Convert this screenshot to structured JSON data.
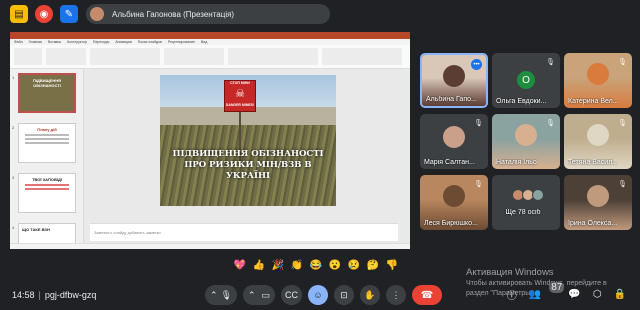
{
  "top_icons": [
    "sticky-note-icon",
    "record-icon",
    "whiteboard-icon"
  ],
  "presenter": {
    "label": "Альбина Гапонова (Презентація)"
  },
  "ppt": {
    "menu": [
      "Файл",
      "Главная",
      "Вставка",
      "Конструктор",
      "Переходы",
      "Анимация",
      "Показ слайдов",
      "Рецензирование",
      "Вид"
    ],
    "thumbnails": [
      {
        "num": "1",
        "title": "ПІДВИЩЕННЯ ОБІЗНАНОСТІ"
      },
      {
        "num": "2",
        "title": "Плану дій"
      },
      {
        "num": "3",
        "title": "ТВОЇ ЗАПОВІДІ"
      },
      {
        "num": "4",
        "title": "ЩО ТАКЕ ВЗН"
      }
    ],
    "slide": {
      "sign_skull": "☠",
      "sign_text": "DANGER MINES!",
      "sign_top": "СТОП МІНИ",
      "headline_1": "ПІДВИЩЕННЯ ОБІЗНАНОСТІ",
      "headline_2": "ПРО РИЗИКИ МІН/ВЗВ В УКРАЇНІ"
    },
    "notes_placeholder": "Заметки к слайду добавить заметки"
  },
  "participants": [
    {
      "name": "Альбина Гапо...",
      "kind": "video",
      "speaking": true,
      "colors": [
        "#d9c7b8",
        "#5b3d33"
      ]
    },
    {
      "name": "Ольга Евдоки...",
      "kind": "letter",
      "letter": "О",
      "colors": [
        "#3c4043",
        "#1e8e3e"
      ]
    },
    {
      "name": "Катерина Вел...",
      "kind": "video",
      "colors": [
        "#c9a37a",
        "#d97b3d"
      ]
    },
    {
      "name": "Марія Салтан...",
      "kind": "avatar",
      "colors": [
        "#3c4043",
        "#caa08a"
      ]
    },
    {
      "name": "Наталія Ільо",
      "kind": "video",
      "colors": [
        "#8aa2a0",
        "#d7b08f"
      ]
    },
    {
      "name": "Тетяна Васил...",
      "kind": "video",
      "colors": [
        "#bfae8e",
        "#e0d6c4"
      ]
    },
    {
      "name": "Леся Бирюшко...",
      "kind": "video",
      "colors": [
        "#b8865f",
        "#6d4b33"
      ]
    },
    {
      "name": "Ще 78 осіб",
      "kind": "more",
      "colors": [
        "#3c4043",
        "#c58b6b"
      ]
    },
    {
      "name": "Ірина Олекса...",
      "kind": "video",
      "colors": [
        "#4d4036",
        "#c09a7d"
      ]
    }
  ],
  "reactions": [
    "💖",
    "👍",
    "🎉",
    "👏",
    "😂",
    "😮",
    "😢",
    "🤔",
    "👎"
  ],
  "activation": {
    "title": "Активация Windows",
    "line1": "Чтобы активировать Windows, перейдите в",
    "line2": "раздел \"Параметры\"."
  },
  "meeting": {
    "time": "14:58",
    "code": "pgj-dfbw-gzq"
  },
  "controls": {
    "mic": "mic-icon",
    "camera": "camera-icon",
    "captions": "captions-icon",
    "reactions": "emoji-icon",
    "present": "present-icon",
    "hand": "raise-hand-icon",
    "more": "more-options-icon",
    "end": "end-call-icon"
  },
  "right_controls": {
    "people_count": "87"
  }
}
